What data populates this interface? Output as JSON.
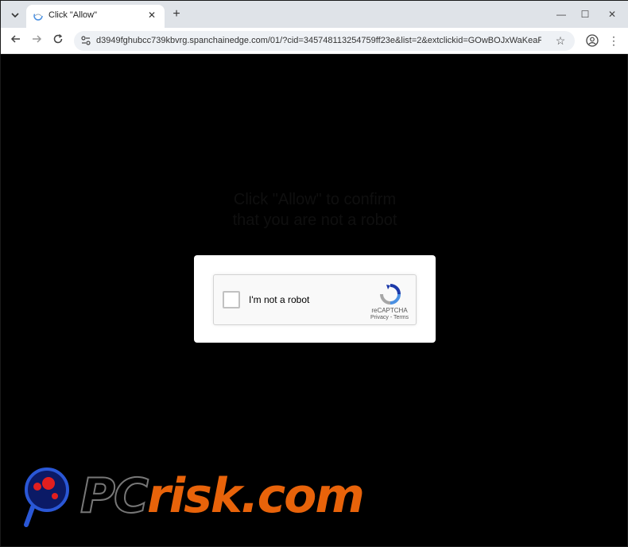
{
  "browser": {
    "tab_title": "Click \"Allow\"",
    "url": "d3949fghubcc739kbvrg.spanchainedge.com/01/?cid=345748113254759ff23e&list=2&extclickid=GOwBOJxWaKeaRnDAkN...",
    "new_tab_symbol": "+",
    "close_tab_symbol": "✕",
    "minimize_symbol": "—",
    "maximize_symbol": "☐",
    "close_window_symbol": "✕"
  },
  "page": {
    "line1": "Click \"Allow\" to confirm",
    "line2": "that you are not a robot"
  },
  "captcha": {
    "label": "I'm not a robot",
    "brand": "reCAPTCHA",
    "links": "Privacy - Terms"
  },
  "watermark": {
    "pc": "PC",
    "risk": "risk.com"
  },
  "colors": {
    "page_bg": "#000000",
    "watermark_orange": "#e8630a",
    "recaptcha_blue": "#4a90e2"
  }
}
